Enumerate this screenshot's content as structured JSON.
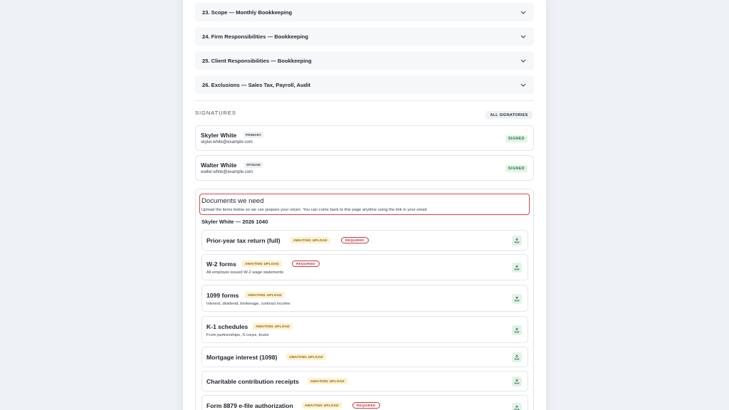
{
  "accordion": [
    {
      "label": "23. Scope — Monthly Bookkeeping"
    },
    {
      "label": "24. Firm Responsibilities — Bookkeeping"
    },
    {
      "label": "25. Client Responsibilities — Bookkeeping"
    },
    {
      "label": "26. Exclusions — Sales Tax, Payroll, Audit"
    }
  ],
  "signatures": {
    "section_label": "SIGNATURES",
    "all_button": "ALL SIGNATORIES",
    "people": [
      {
        "name": "Skyler White",
        "role": "PRIMARY",
        "email": "skyler.white@example.com",
        "status": "SIGNED"
      },
      {
        "name": "Walter White",
        "role": "SPOUSE",
        "email": "walter.white@example.com",
        "status": "SIGNED"
      }
    ]
  },
  "documents": {
    "heading": "Documents we need",
    "intro": "Upload the items below so we can prepare your return. You can come back to this page anytime using the link in your email.",
    "subheading": "Skyler White — 2026 1040",
    "items": [
      {
        "name": "Prior-year tax return (full)",
        "status": "AWAITING UPLOAD",
        "required": "REQUIRED",
        "desc": ""
      },
      {
        "name": "W-2 forms",
        "status": "AWAITING UPLOAD",
        "required": "REQUIRED",
        "desc": "All employer-issued W-2 wage statements"
      },
      {
        "name": "1099 forms",
        "status": "AWAITING UPLOAD",
        "required": "",
        "desc": "Interest, dividend, brokerage, contract income"
      },
      {
        "name": "K-1 schedules",
        "status": "AWAITING UPLOAD",
        "required": "",
        "desc": "From partnerships, S-corps, trusts"
      },
      {
        "name": "Mortgage interest (1098)",
        "status": "AWAITING UPLOAD",
        "required": "",
        "desc": ""
      },
      {
        "name": "Charitable contribution receipts",
        "status": "AWAITING UPLOAD",
        "required": "",
        "desc": ""
      },
      {
        "name": "Form 8879 e-file authorization",
        "status": "AWAITING UPLOAD",
        "required": "REQUIRED",
        "desc": ""
      }
    ]
  },
  "colors": {
    "background": "#eef1f5",
    "signed_bg": "#e3f4e8",
    "signed_text": "#1c7a3e",
    "awaiting_bg": "#fdf1cf",
    "awaiting_text": "#8a5a07",
    "required": "#c8383e",
    "highlight_border": "#d9464b"
  },
  "icons": {
    "accordion_toggle": "chevron-down-icon",
    "upload": "upload-icon"
  }
}
